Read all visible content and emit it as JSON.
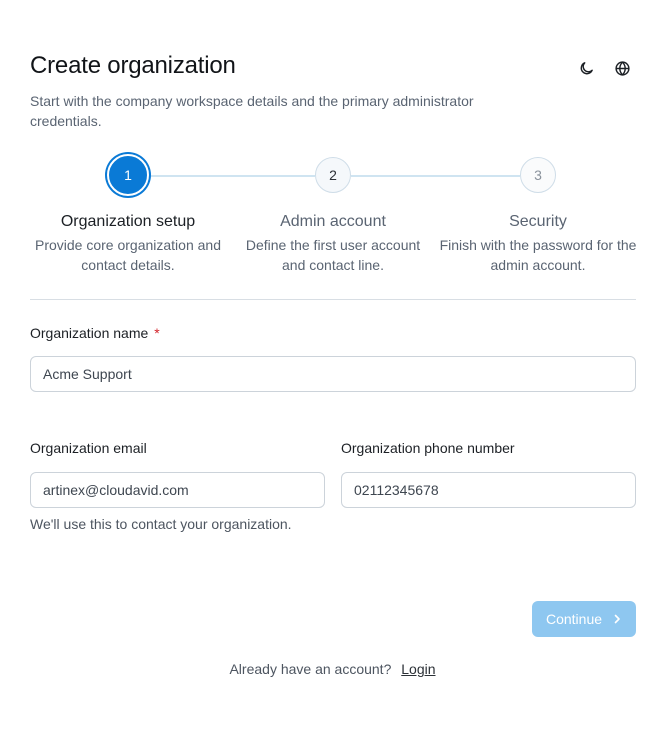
{
  "header": {
    "title": "Create organization",
    "subtitle": "Start with the company workspace details and the primary administrator credentials.",
    "icons": [
      "moon-icon",
      "globe-icon"
    ]
  },
  "stepper": {
    "steps": [
      {
        "number": "1",
        "label": "Organization setup",
        "description": "Provide core organization and contact details.",
        "state": "active"
      },
      {
        "number": "2",
        "label": "Admin account",
        "description": "Define the first user account and contact line.",
        "state": "pending"
      },
      {
        "number": "3",
        "label": "Security",
        "description": "Finish with the password for the admin account.",
        "state": "pending"
      }
    ],
    "colors": {
      "active": "#0a7ad6",
      "line": "#cfe4f1"
    }
  },
  "form": {
    "org_name": {
      "label": "Organization name",
      "required_mark": "*",
      "value": "Acme Support"
    },
    "org_email": {
      "label": "Organization email",
      "value": "artinex@cloudavid.com",
      "hint": "We'll use this to contact your organization."
    },
    "org_phone": {
      "label": "Organization phone number",
      "value": "02112345678"
    }
  },
  "actions": {
    "continue_label": "Continue",
    "continue_color": "#8ec7f0"
  },
  "footer": {
    "prompt": "Already have an account?",
    "login_label": "Login"
  }
}
